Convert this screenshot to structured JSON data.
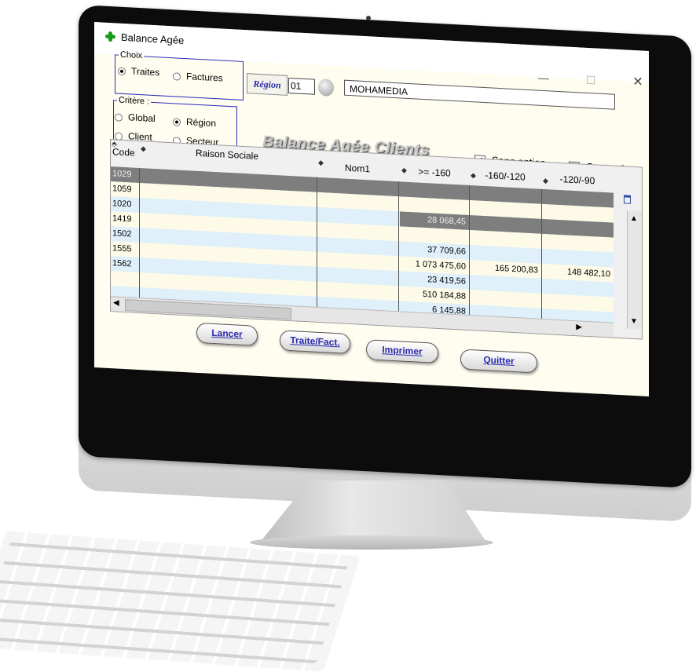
{
  "window": {
    "title": "Balance Agée"
  },
  "choix": {
    "legend": "Choix",
    "options": [
      {
        "label": "Traites",
        "checked": true
      },
      {
        "label": "Factures",
        "checked": false
      }
    ]
  },
  "critere": {
    "legend": "Critère :",
    "options": [
      {
        "label": "Global",
        "checked": false
      },
      {
        "label": "Région",
        "checked": true
      },
      {
        "label": "Client",
        "checked": false
      },
      {
        "label": "Secteur",
        "checked": false
      }
    ]
  },
  "region": {
    "label": "Région",
    "code": "01",
    "name": "MOHAMEDIA"
  },
  "heading": "Balance Agée Clients",
  "checkboxes": {
    "sans_option": {
      "label": "Sans option",
      "checked": true
    },
    "contentieux": {
      "label": "Contentieux",
      "checked": false
    }
  },
  "table": {
    "columns": [
      "Code",
      "Raison Sociale",
      "Nom1",
      ">= -160",
      "-160/-120",
      "-120/-90"
    ],
    "codes": [
      "1029",
      "1059",
      "1020",
      "1419",
      "1502",
      "1555",
      "1562"
    ],
    "col_ge160": [
      "",
      "",
      "28 068,45",
      "",
      "37 709,66",
      "1 073 475,60",
      "23 419,56",
      "510 184,88",
      "6 145,88"
    ],
    "col_160_120": [
      "",
      "",
      "",
      "",
      "",
      "165 200,83",
      "",
      "",
      ""
    ],
    "col_120_90": [
      "",
      "",
      "",
      "",
      "",
      "148 482,10",
      "",
      "",
      ""
    ]
  },
  "buttons": {
    "lancer": "Lancer",
    "traite_fact": "Traite/Fact.",
    "imprimer": "Imprimer",
    "quitter": "Quitter"
  },
  "colors": {
    "accent": "#2a2ab8",
    "selected_row": "#7e7e7e",
    "row_blue": "#dff0fb",
    "row_yellow": "#fdfbe7"
  }
}
